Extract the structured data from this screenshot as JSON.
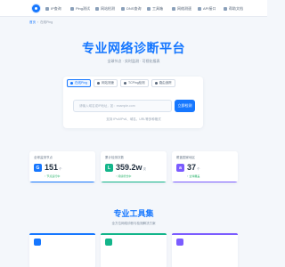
{
  "nav": {
    "items": [
      {
        "label": "IP查询",
        "icon": "globe-icon"
      },
      {
        "label": "Ping测试",
        "icon": "pulse-icon"
      },
      {
        "label": "网站检测",
        "icon": "monitor-icon"
      },
      {
        "label": "DNS查询",
        "icon": "dns-icon"
      },
      {
        "label": "工具箱",
        "icon": "toolbox-icon"
      },
      {
        "label": "网络测速",
        "icon": "speed-icon"
      },
      {
        "label": "API接口",
        "icon": "api-icon"
      },
      {
        "label": "帮助文档",
        "icon": "book-icon"
      }
    ]
  },
  "breadcrumb": {
    "home": "首页",
    "sep": "›",
    "current": "在线Ping"
  },
  "hero": {
    "title": "专业网络诊断平台",
    "subtitle": "全球节点 · 实时监测 · 可视化报表"
  },
  "search": {
    "tabs": [
      {
        "label": "在线Ping",
        "active": true
      },
      {
        "label": "网站测速",
        "active": false
      },
      {
        "label": "TCPing检测",
        "active": false
      },
      {
        "label": "路由追踪",
        "active": false
      }
    ],
    "placeholder": "请输入域名或IP地址，如：example.com",
    "value": "",
    "button": "立即检测",
    "hint": "支持 IPv4/IPv6、域名、URL等多种格式"
  },
  "stats": [
    {
      "label": "全球监测节点",
      "value": "151",
      "unit": "个",
      "trend": "↑ 节点运行中",
      "icon_letter": "G",
      "color": "#1677ff"
    },
    {
      "label": "累计检测次数",
      "value": "359.2w",
      "unit": "次",
      "trend": "↑ 持续增长中",
      "icon_letter": "L",
      "color": "#13b58a"
    },
    {
      "label": "覆盖国家地区",
      "value": "37",
      "unit": "个",
      "trend": "↑ 全球覆盖",
      "icon_letter": "a",
      "color": "#7b5cff"
    }
  ],
  "tools_section": {
    "title": "专业工具集",
    "subtitle": "全方位网络诊断与检测解决方案",
    "tools": [
      {
        "icon": "tool-icon-blue",
        "color": "#1677ff"
      },
      {
        "icon": "tool-icon-green",
        "color": "#13b58a"
      },
      {
        "icon": "tool-icon-purple",
        "color": "#7b5cff"
      }
    ]
  }
}
